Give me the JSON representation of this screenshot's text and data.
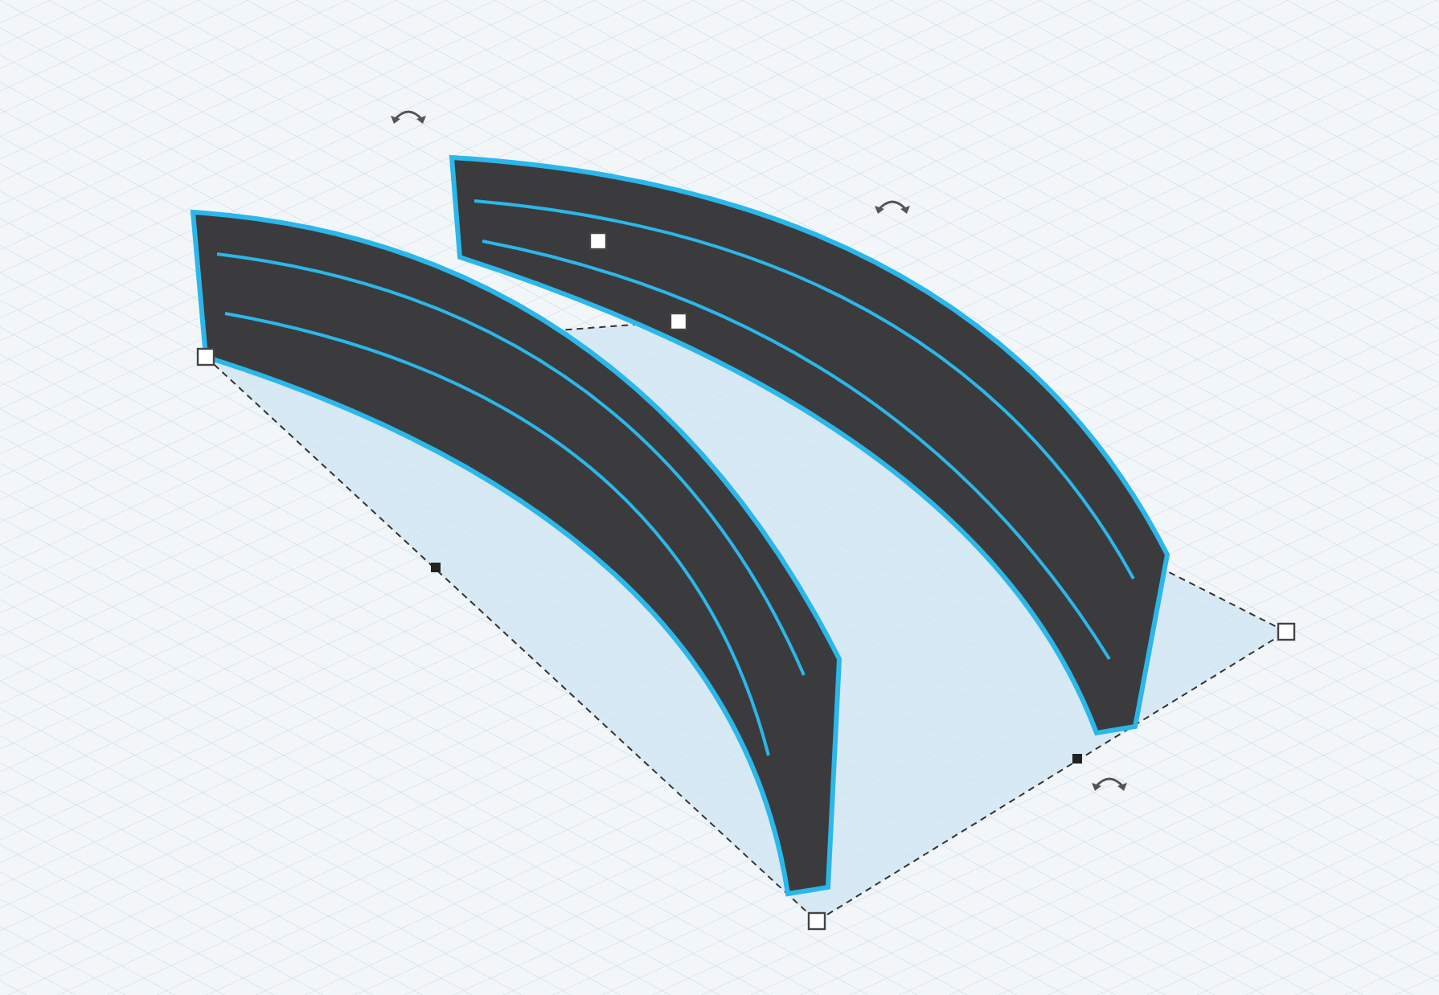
{
  "shapes": [
    {
      "kind": "curved-wall",
      "selected": true
    },
    {
      "kind": "curved-wall",
      "selected": true
    }
  ]
}
